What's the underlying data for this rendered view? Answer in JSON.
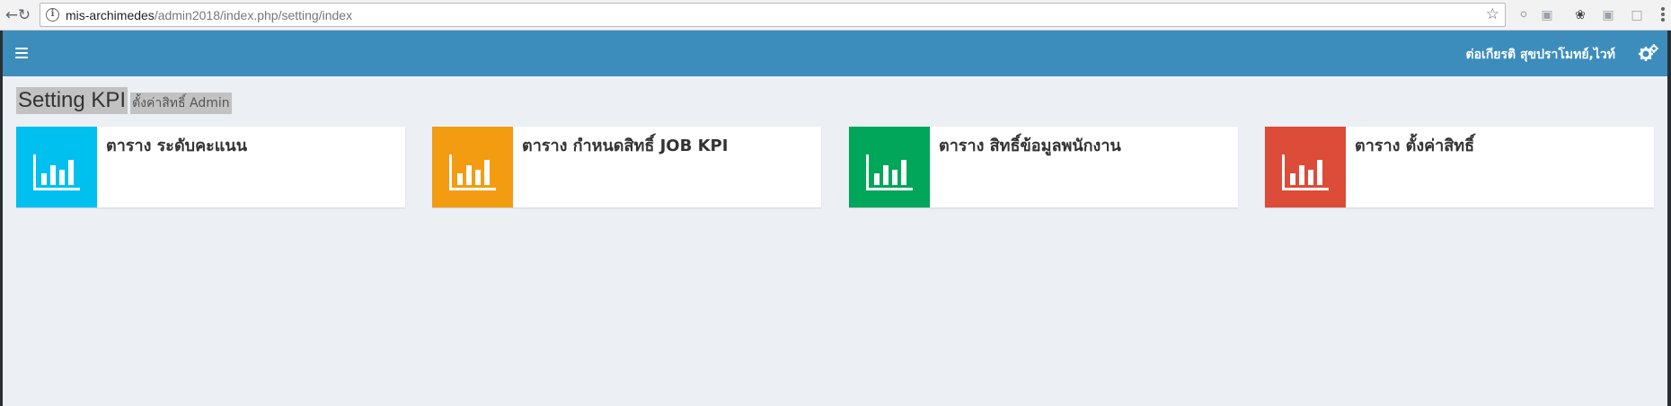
{
  "browser": {
    "url_host": "mis-archimedes",
    "url_path": "/admin2018/index.php/setting/index",
    "icons": [
      "back-icon",
      "reload-icon",
      "info-icon",
      "star-icon",
      "extension-icon",
      "menu-icon"
    ]
  },
  "header": {
    "user_name": "ต่อเกียรติ สุขปราโมทย์,ไวท์",
    "colors": {
      "bar": "#3c8dbc"
    }
  },
  "content": {
    "title": "Setting KPI",
    "subtitle": "ตั้งค่าสิทธิ์ Admin"
  },
  "boxes": [
    {
      "label": "ตาราง ระดับคะแนน",
      "color": "#00c0ef",
      "icon": "bar-chart-icon"
    },
    {
      "label": "ตาราง กำหนดสิทธิ์ JOB KPI",
      "color": "#f39c12",
      "icon": "bar-chart-icon"
    },
    {
      "label": "ตาราง สิทธิ์ข้อมูลพนักงาน",
      "color": "#00a65a",
      "icon": "bar-chart-icon"
    },
    {
      "label": "ตาราง ตั้งค่าสิทธิ์",
      "color": "#dd4b39",
      "icon": "bar-chart-icon"
    }
  ]
}
